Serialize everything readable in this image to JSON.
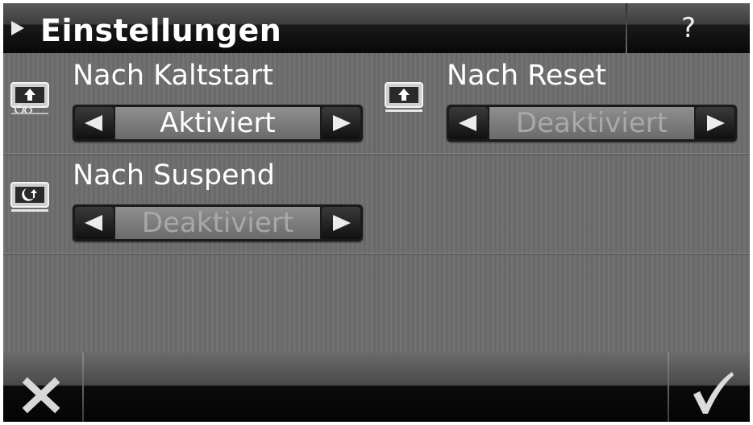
{
  "header": {
    "title": "Einstellungen",
    "help_label": "?"
  },
  "settings": [
    {
      "id": "kaltstart",
      "label": "Nach Kaltstart",
      "value": "Aktiviert",
      "active": true,
      "icon": "cold-start-icon"
    },
    {
      "id": "reset",
      "label": "Nach Reset",
      "value": "Deaktiviert",
      "active": false,
      "icon": "reset-icon"
    },
    {
      "id": "suspend",
      "label": "Nach Suspend",
      "value": "Deaktiviert",
      "active": false,
      "icon": "suspend-icon"
    }
  ],
  "footer": {
    "cancel_icon": "close-icon",
    "confirm_icon": "checkmark-icon"
  },
  "colors": {
    "header_bg": "#080808",
    "panel_bg": "#6e6e6e",
    "active_text": "#ffffff",
    "inactive_text": "#a8a8a8"
  }
}
